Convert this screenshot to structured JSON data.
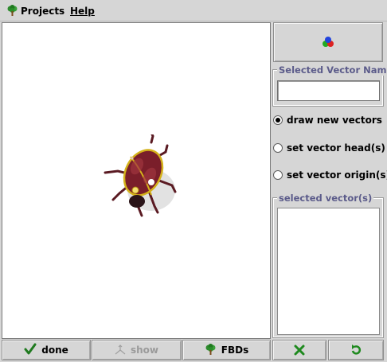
{
  "menu": {
    "projects_label": "Projects",
    "help_label": "Help",
    "projects_icon": "tree-icon"
  },
  "canvas": {
    "image": "ladybug-beetle"
  },
  "panel": {
    "color_button_icon": "rgb-dots-icon",
    "selected_vector_name_title": "Selected Vector Name",
    "selected_vector_name_value": "",
    "modes": [
      {
        "label": "draw new vectors",
        "checked": true
      },
      {
        "label": "set vector head(s)",
        "checked": false
      },
      {
        "label": "set vector origin(s)",
        "checked": false
      }
    ],
    "selected_vectors_title": "selected vector(s)",
    "selected_vectors": []
  },
  "toolbar": {
    "done_label": "done",
    "show_label": "show",
    "fbds_label": "FBDs",
    "done_icon": "checkmark-icon",
    "show_icon": "vector-arrows-icon",
    "fbds_icon": "tree-icon",
    "cancel_icon": "x-icon",
    "reset_icon": "undo-icon"
  },
  "colors": {
    "accent_green": "#1f7a1f",
    "title_color": "#5b5b8a",
    "disabled_text": "#9a9a9a"
  }
}
